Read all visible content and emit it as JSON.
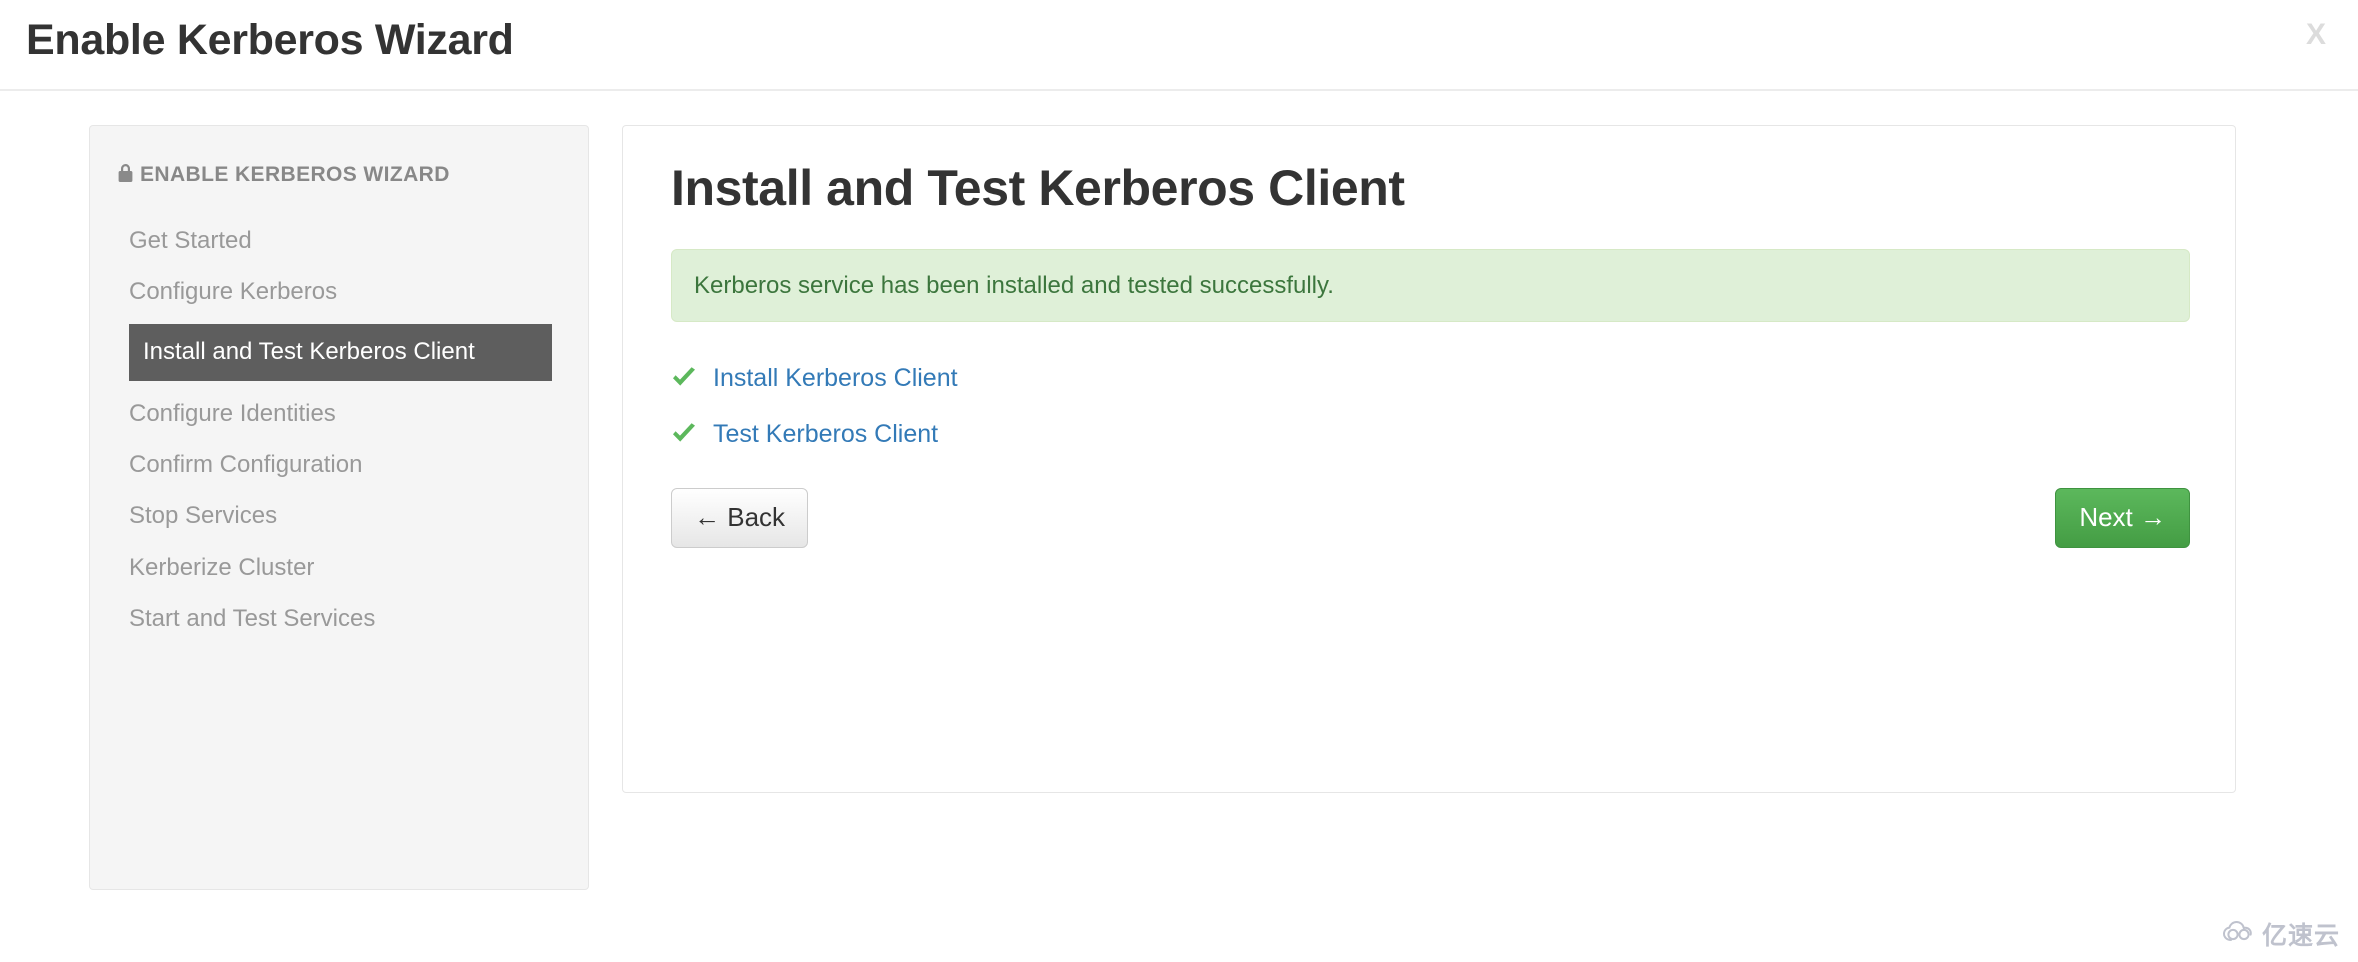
{
  "header": {
    "title": "Enable Kerberos Wizard",
    "close_label": "X"
  },
  "sidebar": {
    "heading": "ENABLE KERBEROS WIZARD",
    "lock_icon": "lock-icon",
    "items": [
      {
        "label": "Get Started",
        "active": false
      },
      {
        "label": "Configure Kerberos",
        "active": false
      },
      {
        "label": "Install and Test Kerberos Client",
        "active": true
      },
      {
        "label": "Configure Identities",
        "active": false
      },
      {
        "label": "Confirm Configuration",
        "active": false
      },
      {
        "label": "Stop Services",
        "active": false
      },
      {
        "label": "Kerberize Cluster",
        "active": false
      },
      {
        "label": "Start and Test Services",
        "active": false
      }
    ]
  },
  "main": {
    "title": "Install and Test Kerberos Client",
    "alert": {
      "message": "Kerberos service has been installed and tested successfully.",
      "type": "success",
      "bg_color": "#dff0d8",
      "text_color": "#3c763d"
    },
    "tasks": [
      {
        "label": "Install Kerberos Client",
        "status_icon": "check-icon",
        "status": "complete"
      },
      {
        "label": "Test Kerberos Client",
        "status_icon": "check-icon",
        "status": "complete"
      }
    ],
    "buttons": {
      "back": "← Back",
      "next": "Next →"
    }
  },
  "watermark": {
    "text": "亿速云",
    "icon": "cloud-icon"
  },
  "colors": {
    "accent_link": "#337ab7",
    "success_green": "#5cb85c",
    "active_item_bg": "#5e5e5e",
    "sidebar_bg": "#f5f5f5"
  }
}
